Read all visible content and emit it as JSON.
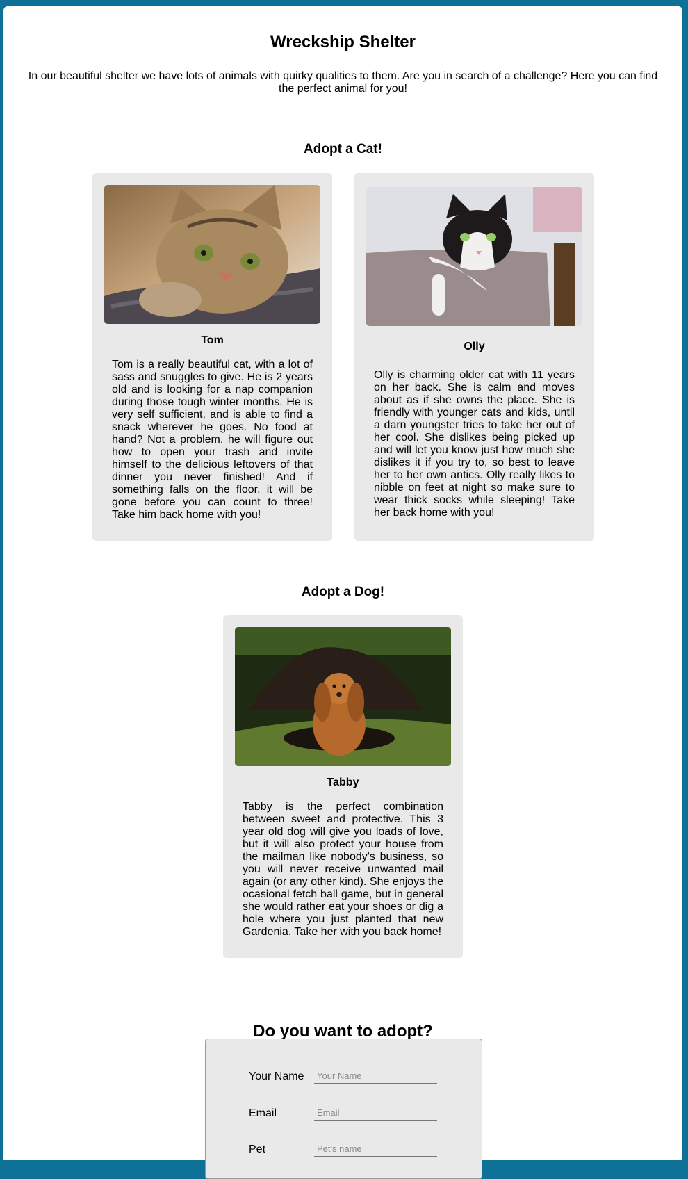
{
  "header": {
    "title": "Wreckship Shelter",
    "intro": "In our beautiful shelter we have lots of animals with quirky qualities to them. Are you in search of a challenge? Here you can find the perfect animal for you!"
  },
  "cats": {
    "title": "Adopt a Cat!",
    "items": [
      {
        "name": "Tom",
        "photo": "tabby-cat-photo",
        "description": "Tom is a really beautiful cat, with a lot of sass and snuggles to give. He is 2 years old and is looking for a nap companion during those tough winter months. He is very self sufficient, and is able to find a snack wherever he goes. No food at hand? Not a problem, he will figure out how to open your trash and invite himself to the delicious leftovers of that dinner you never finished! And if something falls on the floor, it will be gone before you can count to three! Take him back home with you!"
      },
      {
        "name": "Olly",
        "photo": "black-white-cat-photo",
        "description": "Olly is charming older cat with 11 years on her back. She is calm and moves about as if she owns the place. She is friendly with younger cats and kids, until a darn youngster tries to take her out of her cool. She dislikes being picked up and will let you know just how much she dislikes it if you try to, so best to leave her to her own antics. Olly really likes to nibble on feet at night so make sure to wear thick socks while sleeping! Take her back home with you!"
      }
    ]
  },
  "dogs": {
    "title": "Adopt a Dog!",
    "items": [
      {
        "name": "Tabby",
        "photo": "spaniel-dog-photo",
        "description": "Tabby is the perfect combination between sweet and protective. This 3 year old dog will give you loads of love, but it will also protect your house from the mailman like nobody's business, so you will never receive unwanted mail again (or any other kind). She enjoys the ocasional fetch ball game, but in general she would rather eat your shoes or dig a hole where you just planted that new Gardenia. Take her with you back home!"
      }
    ]
  },
  "form": {
    "title": "Do you want to adopt?",
    "fields": [
      {
        "label": "Your Name",
        "placeholder": "Your Name"
      },
      {
        "label": "Email",
        "placeholder": "Email"
      },
      {
        "label": "Pet",
        "placeholder": "Pet's name"
      }
    ]
  },
  "colors": {
    "frame": "#0e7196",
    "card": "#e9e9e9"
  }
}
